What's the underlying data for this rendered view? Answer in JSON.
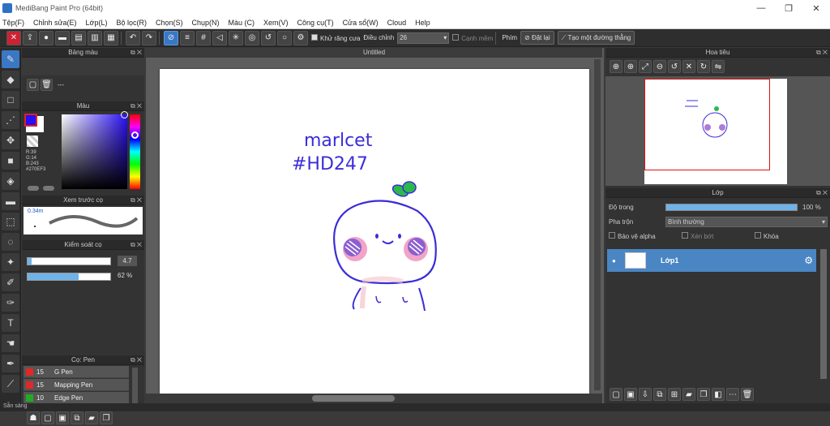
{
  "window": {
    "title": "MediBang Paint Pro (64bit)"
  },
  "menu": [
    "Tệp(F)",
    "Chỉnh sửa(E)",
    "Lớp(L)",
    "Bộ lọc(R)",
    "Chọn(S)",
    "Chụp(N)",
    "Màu (C)",
    "Xem(V)",
    "Công cụ(T)",
    "Cửa sổ(W)",
    "Cloud",
    "Help"
  ],
  "toolbar": {
    "antialias_label": "Khử răng cưa",
    "adjust_label": "Điều chỉnh",
    "adjust_value": "26",
    "edge_label": "Cạnh mềm",
    "key_label": "Phím",
    "reset_label": "Đặt lại",
    "line_label": "Tạo một đường thẳng"
  },
  "panels": {
    "palette": {
      "title": "Bảng màu",
      "name": "---"
    },
    "color": {
      "title": "Màu",
      "r": "R:39",
      "g": "G:14",
      "b": "B:243",
      "hex": "#270EF3",
      "main_color": "#270ef3"
    },
    "preview": {
      "title": "Xem trước cọ",
      "size": "0.34m"
    },
    "brush_control": {
      "title": "Kiểm soát cọ",
      "size_value": "4.7",
      "opacity_value": "62 %",
      "size_fraction": 0.047,
      "opacity_fraction": 0.62
    },
    "brushes": {
      "title": "Cọ: Pen",
      "items": [
        {
          "size": "15",
          "name": "G Pen",
          "color": "#e0282a"
        },
        {
          "size": "15",
          "name": "Mapping Pen",
          "color": "#e0282a"
        },
        {
          "size": "10",
          "name": "Edge Pen",
          "color": "#22aa22"
        }
      ]
    }
  },
  "canvas": {
    "tab": "Untitled",
    "text_line1": "marlcet",
    "text_line2": "#HD247"
  },
  "navigator": {
    "title": "Hoa tiêu"
  },
  "layers": {
    "title": "Lớp",
    "opacity_label": "Độ trong",
    "opacity_value": "100 %",
    "opacity_fraction": 1.0,
    "blend_label": "Pha trộn",
    "blend_value": "Bình thường",
    "protect_alpha": "Bảo vệ alpha",
    "clip": "Xén bớt",
    "lock": "Khóa",
    "layer_name": "Lớp1"
  },
  "status": "Sẵn sàng"
}
